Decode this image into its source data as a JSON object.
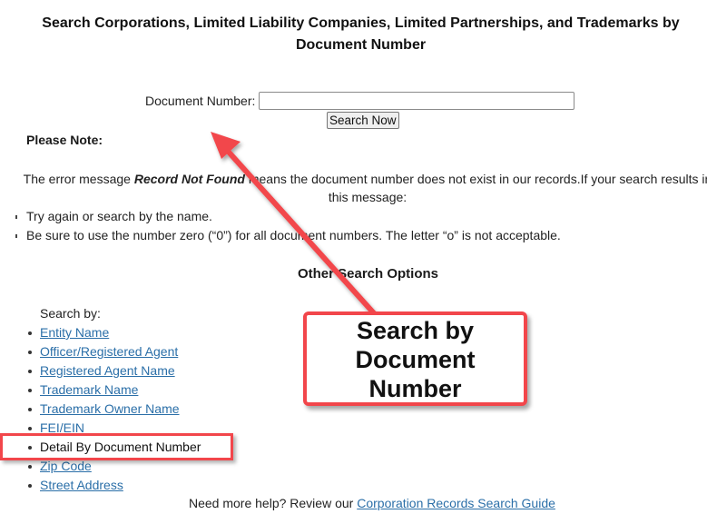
{
  "page": {
    "title": "Search Corporations, Limited Liability Companies, Limited Partnerships, and Trademarks by Document Number"
  },
  "form": {
    "label": "Document Number:",
    "input_value": "",
    "submit_label": "Search Now"
  },
  "note": {
    "heading": "Please Note:",
    "text_before": "The error message ",
    "emphasis": "Record Not Found",
    "text_after": " means the document number does not exist in our records.If your search results in this message:",
    "bullets": [
      "Try again or search by the name.",
      "Be sure to use the number zero (“0”) for all document numbers. The letter “o” is not acceptable."
    ]
  },
  "other_options": {
    "heading": "Other Search Options",
    "search_by_label": "Search by:",
    "items": [
      {
        "label": "Entity Name",
        "link": true
      },
      {
        "label": "Officer/Registered Agent",
        "link": true
      },
      {
        "label": "Registered Agent Name",
        "link": true
      },
      {
        "label": "Trademark Name",
        "link": true
      },
      {
        "label": "Trademark Owner Name",
        "link": true
      },
      {
        "label": "FEI/EIN",
        "link": true
      },
      {
        "label": "Detail By Document Number",
        "link": false
      },
      {
        "label": "Zip Code",
        "link": true
      },
      {
        "label": "Street Address",
        "link": true
      }
    ]
  },
  "help": {
    "text": "Need more help? Review our ",
    "link_label": "Corporation Records Search Guide"
  },
  "annotation": {
    "callout_text": "Search by Document Number",
    "accent_color": "#f2464b"
  }
}
